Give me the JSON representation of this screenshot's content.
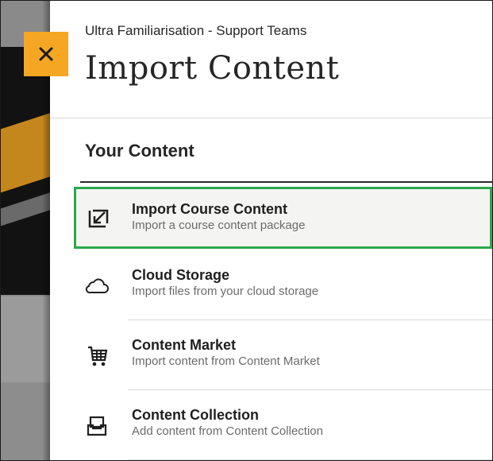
{
  "header": {
    "course_name": "Ultra Familiarisation - Support Teams",
    "title": "Import Content",
    "close_label": "×"
  },
  "section": {
    "heading": "Your Content"
  },
  "items": [
    {
      "label": "Import Course Content",
      "description": "Import a course content package",
      "icon": "import-arrow-icon",
      "selected": true
    },
    {
      "label": "Cloud Storage",
      "description": "Import files from your cloud storage",
      "icon": "cloud-icon"
    },
    {
      "label": "Content Market",
      "description": "Import content from Content Market",
      "icon": "cart-icon"
    },
    {
      "label": "Content Collection",
      "description": "Add content from Content Collection",
      "icon": "inbox-tray-icon"
    }
  ],
  "colors": {
    "accent_close": "#f5a623",
    "selected_border": "#2aa84a",
    "text": "#262626"
  }
}
